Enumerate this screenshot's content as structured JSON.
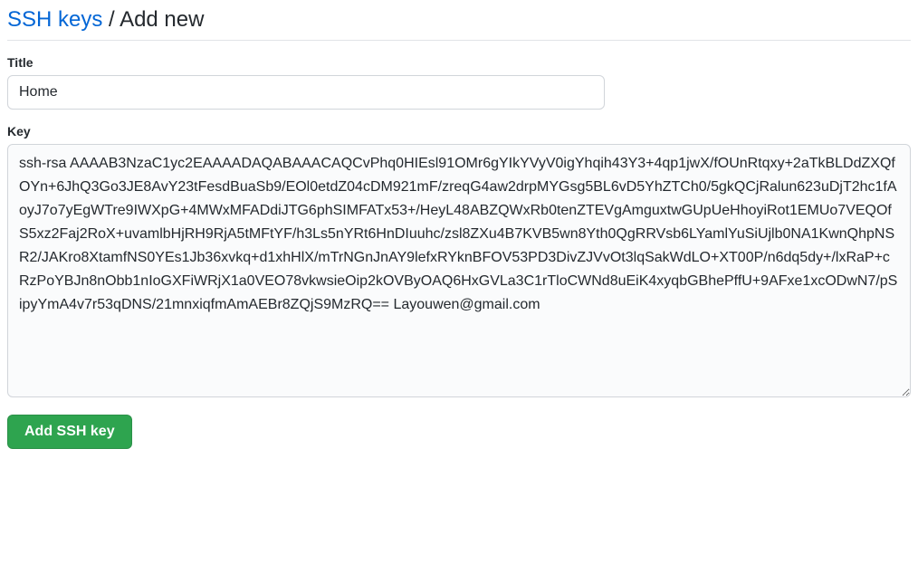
{
  "header": {
    "breadcrumb_link": "SSH keys",
    "separator": " / ",
    "current": "Add new"
  },
  "form": {
    "title_label": "Title",
    "title_value": "Home",
    "key_label": "Key",
    "key_value": "ssh-rsa AAAAB3NzaC1yc2EAAAADAQABAAACAQCvPhq0HIEsl91OMr6gYIkYVyV0igYhqih43Y3+4qp1jwX/fOUnRtqxy+2aTkBLDdZXQfOYn+6JhQ3Go3JE8AvY23tFesdBuaSb9/EOl0etdZ04cDM921mF/zreqG4aw2drpMYGsg5BL6vD5YhZTCh0/5gkQCjRalun623uDjT2hc1fAoyJ7o7yEgWTre9IWXpG+4MWxMFADdiJTG6phSIMFATx53+/HeyL48ABZQWxRb0tenZTEVgAmguxtwGUpUeHhoyiRot1EMUo7VEQOfS5xz2Faj2RoX+uvamlbHjRH9RjA5tMFtYF/h3Ls5nYRt6HnDIuuhc/zsl8ZXu4B7KVB5wn8Yth0QgRRVsb6LYamlYuSiUjlb0NA1KwnQhpNSR2/JAKro8XtamfNS0YEs1Jb36xvkq+d1xhHlX/mTrNGnJnAY9lefxRYknBFOV53PD3DivZJVvOt3lqSakWdLO+XT00P/n6dq5dy+/lxRaP+cRzPoYBJn8nObb1nIoGXFiWRjX1a0VEO78vkwsieOip2kOVByOAQ6HxGVLa3C1rTloCWNd8uEiK4xyqbGBhePffU+9AFxe1xcODwN7/pSipyYmA4v7r53qDNS/21mnxiqfmAmAEBr8ZQjS9MzRQ== Layouwen@gmail.com",
    "submit_label": "Add SSH key"
  }
}
